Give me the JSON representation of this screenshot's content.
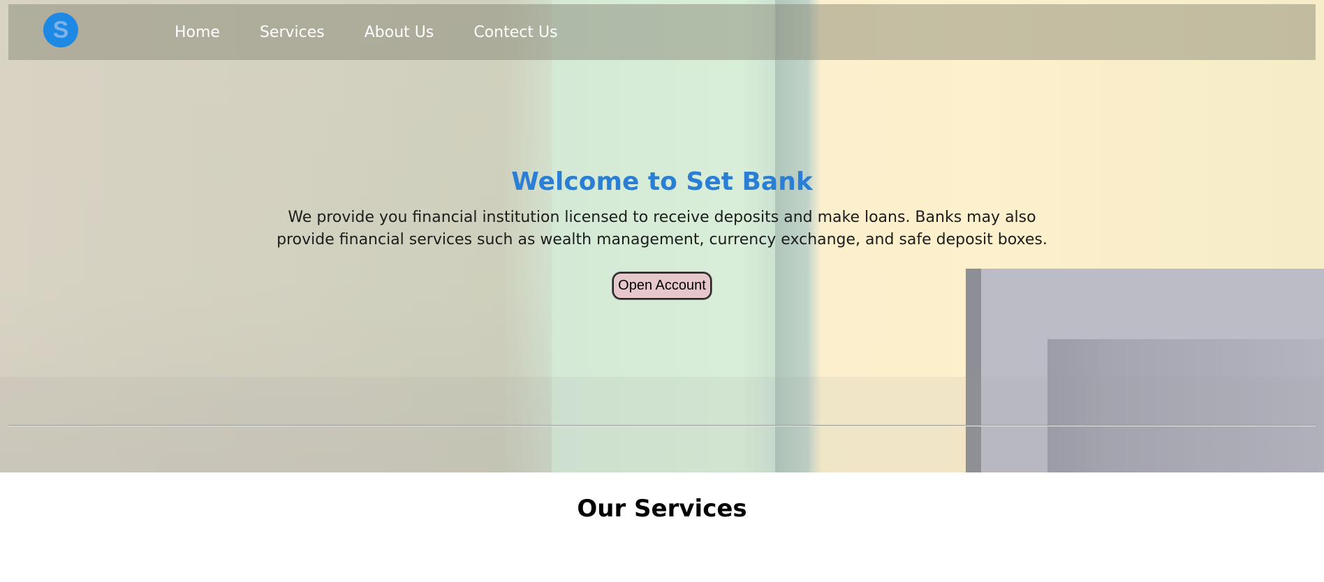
{
  "brand": {
    "logo_letter": "S",
    "logo_color": "#1e88e5"
  },
  "nav": {
    "items": [
      {
        "label": "Home"
      },
      {
        "label": "Services"
      },
      {
        "label": "About Us"
      },
      {
        "label": "Contect Us"
      }
    ]
  },
  "hero": {
    "title": "Welcome to Set Bank",
    "title_color": "#2a7fd4",
    "description": "We provide you financial institution licensed to receive deposits and make loans. Banks may also provide financial services such as wealth management, currency exchange, and safe deposit boxes.",
    "cta_label": "Open Account"
  },
  "services": {
    "title": "Our Services"
  }
}
